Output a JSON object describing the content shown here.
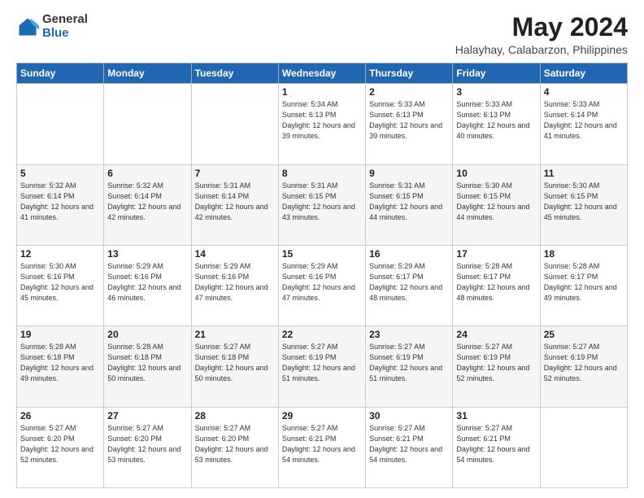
{
  "logo": {
    "general": "General",
    "blue": "Blue"
  },
  "title": "May 2024",
  "subtitle": "Halayhay, Calabarzon, Philippines",
  "weekdays": [
    "Sunday",
    "Monday",
    "Tuesday",
    "Wednesday",
    "Thursday",
    "Friday",
    "Saturday"
  ],
  "weeks": [
    [
      {
        "day": "",
        "info": ""
      },
      {
        "day": "",
        "info": ""
      },
      {
        "day": "",
        "info": ""
      },
      {
        "day": "1",
        "info": "Sunrise: 5:34 AM\nSunset: 6:13 PM\nDaylight: 12 hours\nand 39 minutes."
      },
      {
        "day": "2",
        "info": "Sunrise: 5:33 AM\nSunset: 6:13 PM\nDaylight: 12 hours\nand 39 minutes."
      },
      {
        "day": "3",
        "info": "Sunrise: 5:33 AM\nSunset: 6:13 PM\nDaylight: 12 hours\nand 40 minutes."
      },
      {
        "day": "4",
        "info": "Sunrise: 5:33 AM\nSunset: 6:14 PM\nDaylight: 12 hours\nand 41 minutes."
      }
    ],
    [
      {
        "day": "5",
        "info": "Sunrise: 5:32 AM\nSunset: 6:14 PM\nDaylight: 12 hours\nand 41 minutes."
      },
      {
        "day": "6",
        "info": "Sunrise: 5:32 AM\nSunset: 6:14 PM\nDaylight: 12 hours\nand 42 minutes."
      },
      {
        "day": "7",
        "info": "Sunrise: 5:31 AM\nSunset: 6:14 PM\nDaylight: 12 hours\nand 42 minutes."
      },
      {
        "day": "8",
        "info": "Sunrise: 5:31 AM\nSunset: 6:15 PM\nDaylight: 12 hours\nand 43 minutes."
      },
      {
        "day": "9",
        "info": "Sunrise: 5:31 AM\nSunset: 6:15 PM\nDaylight: 12 hours\nand 44 minutes."
      },
      {
        "day": "10",
        "info": "Sunrise: 5:30 AM\nSunset: 6:15 PM\nDaylight: 12 hours\nand 44 minutes."
      },
      {
        "day": "11",
        "info": "Sunrise: 5:30 AM\nSunset: 6:15 PM\nDaylight: 12 hours\nand 45 minutes."
      }
    ],
    [
      {
        "day": "12",
        "info": "Sunrise: 5:30 AM\nSunset: 6:16 PM\nDaylight: 12 hours\nand 45 minutes."
      },
      {
        "day": "13",
        "info": "Sunrise: 5:29 AM\nSunset: 6:16 PM\nDaylight: 12 hours\nand 46 minutes."
      },
      {
        "day": "14",
        "info": "Sunrise: 5:29 AM\nSunset: 6:16 PM\nDaylight: 12 hours\nand 47 minutes."
      },
      {
        "day": "15",
        "info": "Sunrise: 5:29 AM\nSunset: 6:16 PM\nDaylight: 12 hours\nand 47 minutes."
      },
      {
        "day": "16",
        "info": "Sunrise: 5:29 AM\nSunset: 6:17 PM\nDaylight: 12 hours\nand 48 minutes."
      },
      {
        "day": "17",
        "info": "Sunrise: 5:28 AM\nSunset: 6:17 PM\nDaylight: 12 hours\nand 48 minutes."
      },
      {
        "day": "18",
        "info": "Sunrise: 5:28 AM\nSunset: 6:17 PM\nDaylight: 12 hours\nand 49 minutes."
      }
    ],
    [
      {
        "day": "19",
        "info": "Sunrise: 5:28 AM\nSunset: 6:18 PM\nDaylight: 12 hours\nand 49 minutes."
      },
      {
        "day": "20",
        "info": "Sunrise: 5:28 AM\nSunset: 6:18 PM\nDaylight: 12 hours\nand 50 minutes."
      },
      {
        "day": "21",
        "info": "Sunrise: 5:27 AM\nSunset: 6:18 PM\nDaylight: 12 hours\nand 50 minutes."
      },
      {
        "day": "22",
        "info": "Sunrise: 5:27 AM\nSunset: 6:19 PM\nDaylight: 12 hours\nand 51 minutes."
      },
      {
        "day": "23",
        "info": "Sunrise: 5:27 AM\nSunset: 6:19 PM\nDaylight: 12 hours\nand 51 minutes."
      },
      {
        "day": "24",
        "info": "Sunrise: 5:27 AM\nSunset: 6:19 PM\nDaylight: 12 hours\nand 52 minutes."
      },
      {
        "day": "25",
        "info": "Sunrise: 5:27 AM\nSunset: 6:19 PM\nDaylight: 12 hours\nand 52 minutes."
      }
    ],
    [
      {
        "day": "26",
        "info": "Sunrise: 5:27 AM\nSunset: 6:20 PM\nDaylight: 12 hours\nand 52 minutes."
      },
      {
        "day": "27",
        "info": "Sunrise: 5:27 AM\nSunset: 6:20 PM\nDaylight: 12 hours\nand 53 minutes."
      },
      {
        "day": "28",
        "info": "Sunrise: 5:27 AM\nSunset: 6:20 PM\nDaylight: 12 hours\nand 53 minutes."
      },
      {
        "day": "29",
        "info": "Sunrise: 5:27 AM\nSunset: 6:21 PM\nDaylight: 12 hours\nand 54 minutes."
      },
      {
        "day": "30",
        "info": "Sunrise: 5:27 AM\nSunset: 6:21 PM\nDaylight: 12 hours\nand 54 minutes."
      },
      {
        "day": "31",
        "info": "Sunrise: 5:27 AM\nSunset: 6:21 PM\nDaylight: 12 hours\nand 54 minutes."
      },
      {
        "day": "",
        "info": ""
      }
    ]
  ]
}
